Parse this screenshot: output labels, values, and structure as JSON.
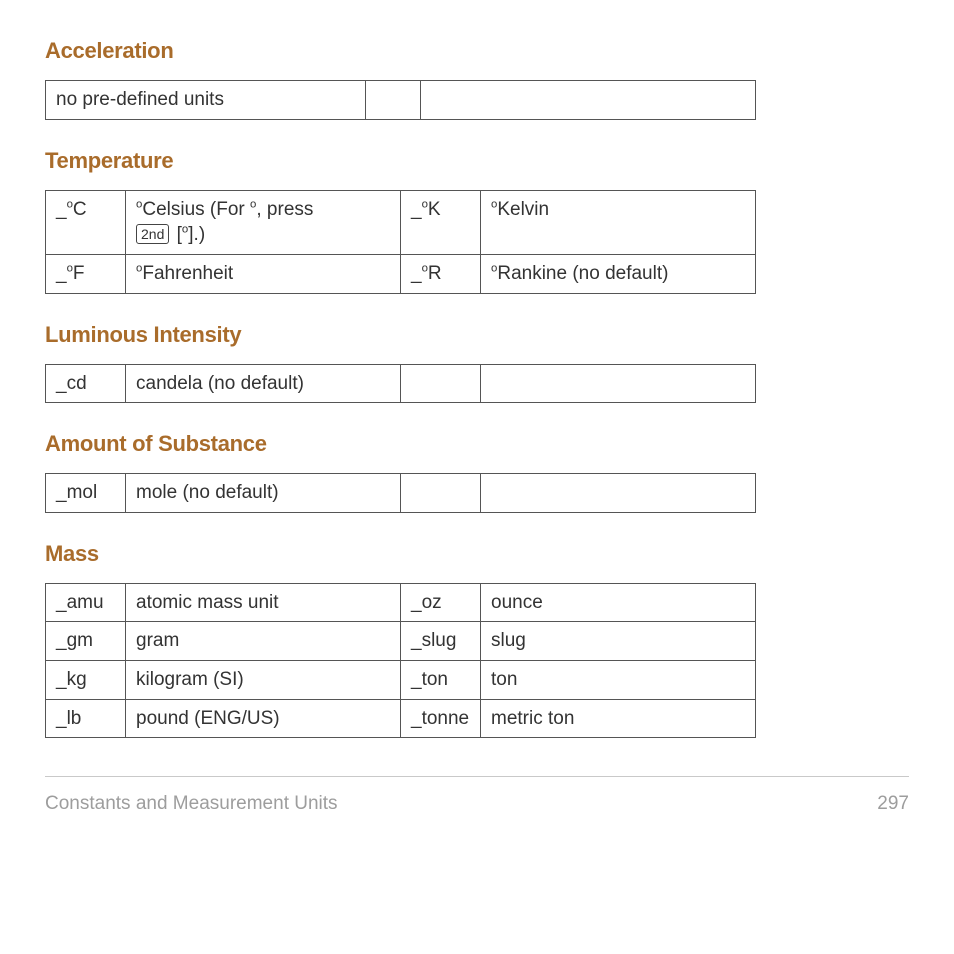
{
  "sections": {
    "acceleration": {
      "heading": "Acceleration",
      "none": "no pre-defined units"
    },
    "temperature": {
      "heading": "Temperature",
      "rows": [
        {
          "sym_a": "_°C",
          "desc_a_pre": "°Celsius (For °, press",
          "kbd1": "2nd",
          "kbd2": "°",
          "desc_a_post": ".)",
          "sym_b": "_°K",
          "desc_b": "°Kelvin"
        },
        {
          "sym_a": "_°F",
          "desc_a": "°Fahrenheit",
          "sym_b": "_°R",
          "desc_b": "°Rankine (no default)"
        }
      ]
    },
    "luminous": {
      "heading": "Luminous Intensity",
      "row": {
        "sym_a": "_cd",
        "desc_a": "candela (no default)",
        "sym_b": "",
        "desc_b": ""
      }
    },
    "amount": {
      "heading": "Amount of Substance",
      "row": {
        "sym_a": "_mol",
        "desc_a": "mole (no default)",
        "sym_b": "",
        "desc_b": ""
      }
    },
    "mass": {
      "heading": "Mass",
      "rows": [
        {
          "sym_a": "_amu",
          "desc_a": "atomic mass unit",
          "sym_b": "_oz",
          "desc_b": "ounce"
        },
        {
          "sym_a": "_gm",
          "desc_a": "gram",
          "sym_b": "_slug",
          "desc_b": "slug"
        },
        {
          "sym_a": "_kg",
          "desc_a": "kilogram (SI)",
          "sym_b": "_ton",
          "desc_b": "ton"
        },
        {
          "sym_a": "_lb",
          "desc_a": "pound (ENG/US)",
          "sym_b": "_tonne",
          "desc_b": "metric ton"
        }
      ]
    }
  },
  "footer": {
    "title": "Constants and Measurement Units",
    "page": "297"
  }
}
